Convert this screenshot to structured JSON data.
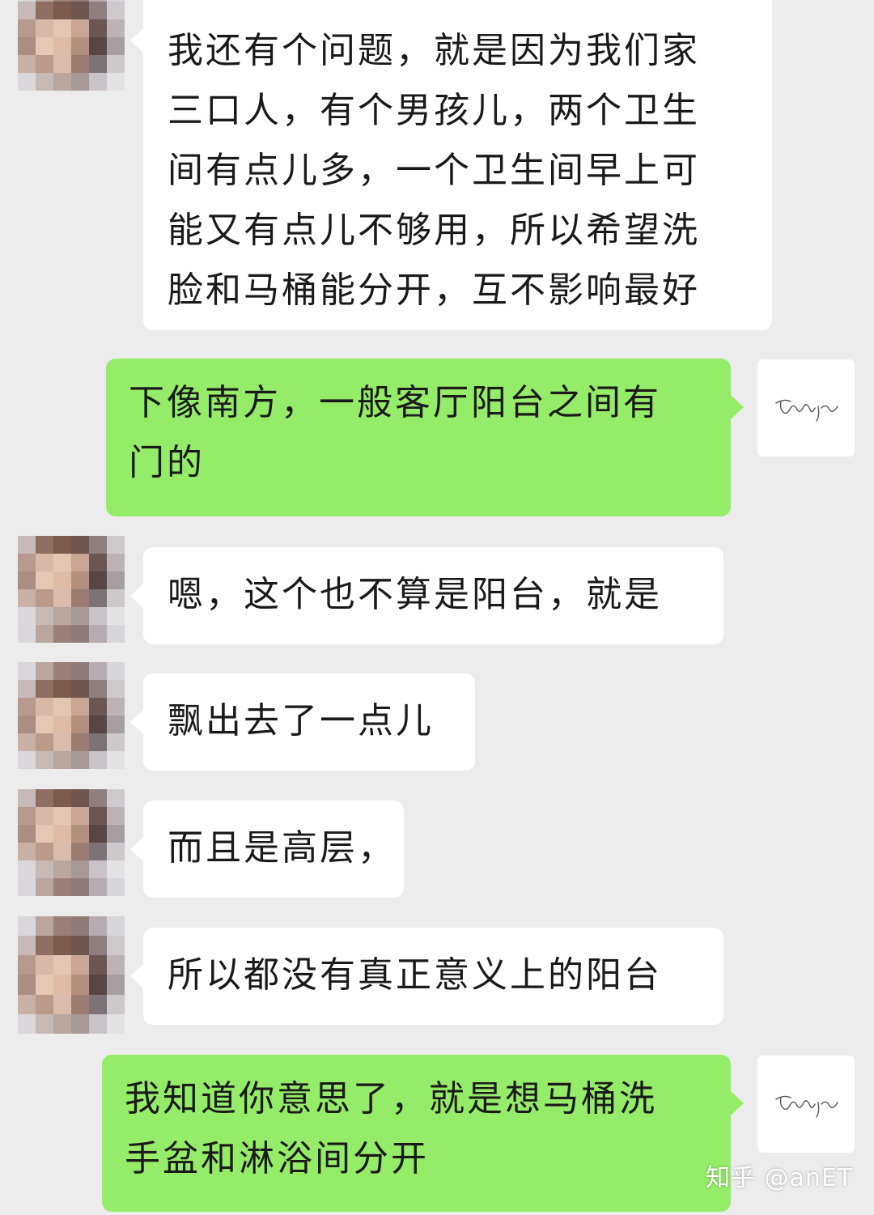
{
  "messages": [
    {
      "side": "in",
      "lines": [
        "我还有个问题，就是因为我们家",
        "三口人，有个男孩儿，两个卫生",
        "间有点儿多，一个卫生间早上可",
        "能又有点儿不够用，所以希望洗",
        "脸和马桶能分开，互不影响最好"
      ]
    },
    {
      "side": "out",
      "lines": [
        "下像南方，一般客厅阳台之间有",
        "门的"
      ]
    },
    {
      "side": "in",
      "lines": [
        "嗯，这个也不算是阳台，就是"
      ]
    },
    {
      "side": "in",
      "lines": [
        "飘出去了一点儿"
      ]
    },
    {
      "side": "in",
      "lines": [
        "而且是高层，"
      ]
    },
    {
      "side": "in",
      "lines": [
        "所以都没有真正意义上的阳台"
      ]
    },
    {
      "side": "out",
      "lines": [
        "我知道你意思了，就是想马桶洗",
        "手盆和淋浴间分开"
      ]
    }
  ],
  "watermark": "知乎 @anET",
  "colors": {
    "background": "#ececec",
    "incoming_bubble": "#ffffff",
    "outgoing_bubble": "#95ec69",
    "text": "#1a1a1a"
  },
  "icons": {
    "contact_avatar": "pixelated-portrait",
    "my_avatar": "signature-logo"
  }
}
